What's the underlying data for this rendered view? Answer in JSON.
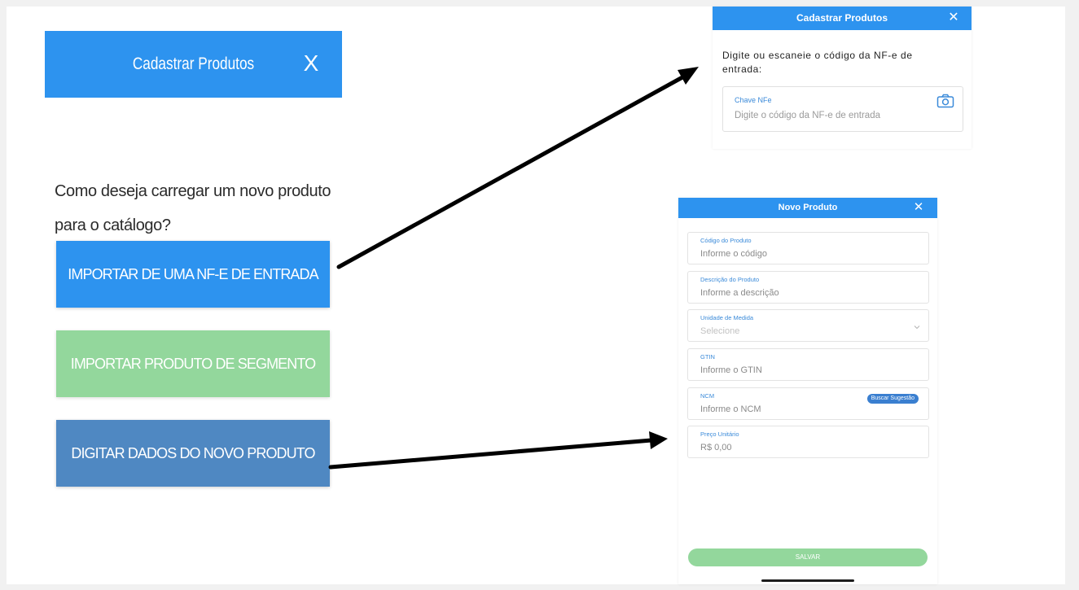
{
  "left_dialog": {
    "title": "Cadastrar Produtos",
    "close_label": "X",
    "question": "Como deseja carregar um novo produto para o catálogo?",
    "options": [
      {
        "label": "IMPORTAR DE UMA NF-E DE ENTRADA",
        "color": "#2d93ef"
      },
      {
        "label": "IMPORTAR PRODUTO DE SEGMENTO",
        "color": "#93d79c"
      },
      {
        "label": "DIGITAR DADOS DO NOVO PRODUTO",
        "color": "#4f88c2"
      }
    ]
  },
  "nfe_dialog": {
    "title": "Cadastrar Produtos",
    "close_label": "✕",
    "instruction": "Digite ou escaneie o código da NF-e de entrada:",
    "field": {
      "label": "Chave NFe",
      "placeholder": "Digite o código da NF-e de entrada",
      "icon": "camera-icon"
    }
  },
  "novo_dialog": {
    "title": "Novo Produto",
    "close_label": "✕",
    "fields": [
      {
        "label": "Código do Produto",
        "placeholder": "Informe o código"
      },
      {
        "label": "Descrição do Produto",
        "placeholder": "Informe a descrição"
      },
      {
        "label": "Unidade de Medida",
        "placeholder": "Selecione"
      },
      {
        "label": "GTIN",
        "placeholder": "Informe o GTIN"
      },
      {
        "label": "NCM",
        "placeholder": "Informe o NCM",
        "button": "Buscar Sugestão"
      },
      {
        "label": "Preço Unitário",
        "value": "R$ 0,00"
      }
    ],
    "save_label": "SALVAR"
  },
  "colors": {
    "primary": "#2d93ef",
    "success": "#93d79c",
    "secondary": "#4f88c2"
  }
}
